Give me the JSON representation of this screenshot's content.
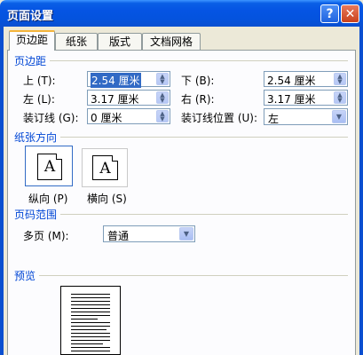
{
  "window": {
    "title": "页面设置",
    "help_glyph": "?",
    "close_glyph": "✕"
  },
  "tabs": [
    {
      "label": "页边距",
      "active": true
    },
    {
      "label": "纸张"
    },
    {
      "label": "版式"
    },
    {
      "label": "文档网格"
    }
  ],
  "margins": {
    "group_title": "页边距",
    "top_label": "上 (T):",
    "top_value": "2.54 厘米",
    "bottom_label": "下 (B):",
    "bottom_value": "2.54 厘米",
    "left_label": "左 (L):",
    "left_value": "3.17 厘米",
    "right_label": "右 (R):",
    "right_value": "3.17 厘米",
    "gutter_label": "装订线 (G):",
    "gutter_value": "0 厘米",
    "gutter_pos_label": "装订线位置 (U):",
    "gutter_pos_value": "左"
  },
  "orientation": {
    "group_title": "纸张方向",
    "portrait_label": "纵向 (P)",
    "landscape_label": "横向 (S)",
    "glyph": "A",
    "selected": "portrait"
  },
  "pages": {
    "group_title": "页码范围",
    "multiple_label": "多页 (M):",
    "multiple_value": "普通"
  },
  "preview": {
    "group_title": "预览"
  },
  "colors": {
    "accent": "#0046D5",
    "title_bar": "#0554E3",
    "selection": "#316AC5"
  },
  "icons": {
    "spin": "spin-arrows-icon",
    "dropdown": "chevron-down-icon"
  }
}
